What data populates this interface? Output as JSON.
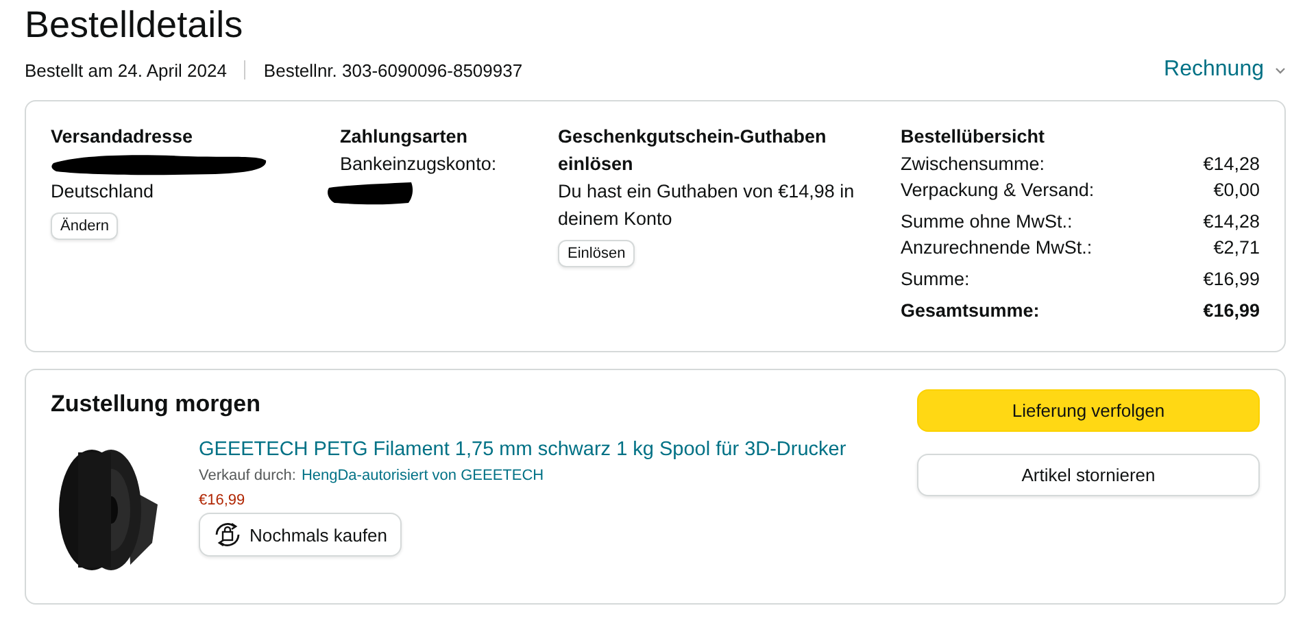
{
  "page_title": "Bestelldetails",
  "order_date": "Bestellt am 24. April 2024",
  "order_number": "Bestellnr. 303-6090096-8509937",
  "invoice_link": "Rechnung",
  "shipping_address": {
    "heading": "Versandadresse",
    "redacted": true,
    "country": "Deutschland",
    "button": "Ändern"
  },
  "payment": {
    "heading": "Zahlungsarten",
    "method": "Bankeinzugskonto:",
    "redacted": true
  },
  "gift_card": {
    "heading": "Geschenkgutschein-Guthaben einlösen",
    "text": "Du hast ein Guthaben von €14,98 in deinem Konto",
    "button": "Einlösen"
  },
  "summary": {
    "heading": "Bestellübersicht",
    "rows": [
      {
        "label": "Zwischensumme:",
        "value": "€14,28",
        "kind": "line"
      },
      {
        "label": "Verpackung & Versand:",
        "value": "€0,00",
        "kind": "line"
      },
      {
        "label": "Summe ohne MwSt.:",
        "value": "€14,28",
        "kind": "group"
      },
      {
        "label": "Anzurechnende MwSt.:",
        "value": "€2,71",
        "kind": "line"
      },
      {
        "label": "Summe:",
        "value": "€16,99",
        "kind": "group"
      },
      {
        "label": "Gesamtsumme:",
        "value": "€16,99",
        "kind": "total"
      }
    ]
  },
  "delivery": {
    "heading": "Zustellung morgen",
    "item": {
      "title": "GEEETECH PETG Filament 1,75 mm schwarz 1 kg Spool für 3D-Drucker",
      "seller_label": "Verkauf durch:",
      "seller": "HengDa-autorisiert von GEEETECH",
      "price": "€16,99",
      "buy_again": "Nochmals kaufen"
    },
    "buttons": [
      {
        "label": "Lieferung verfolgen",
        "kind": "primary"
      },
      {
        "label": "Artikel stornieren",
        "kind": "secondary"
      }
    ]
  }
}
